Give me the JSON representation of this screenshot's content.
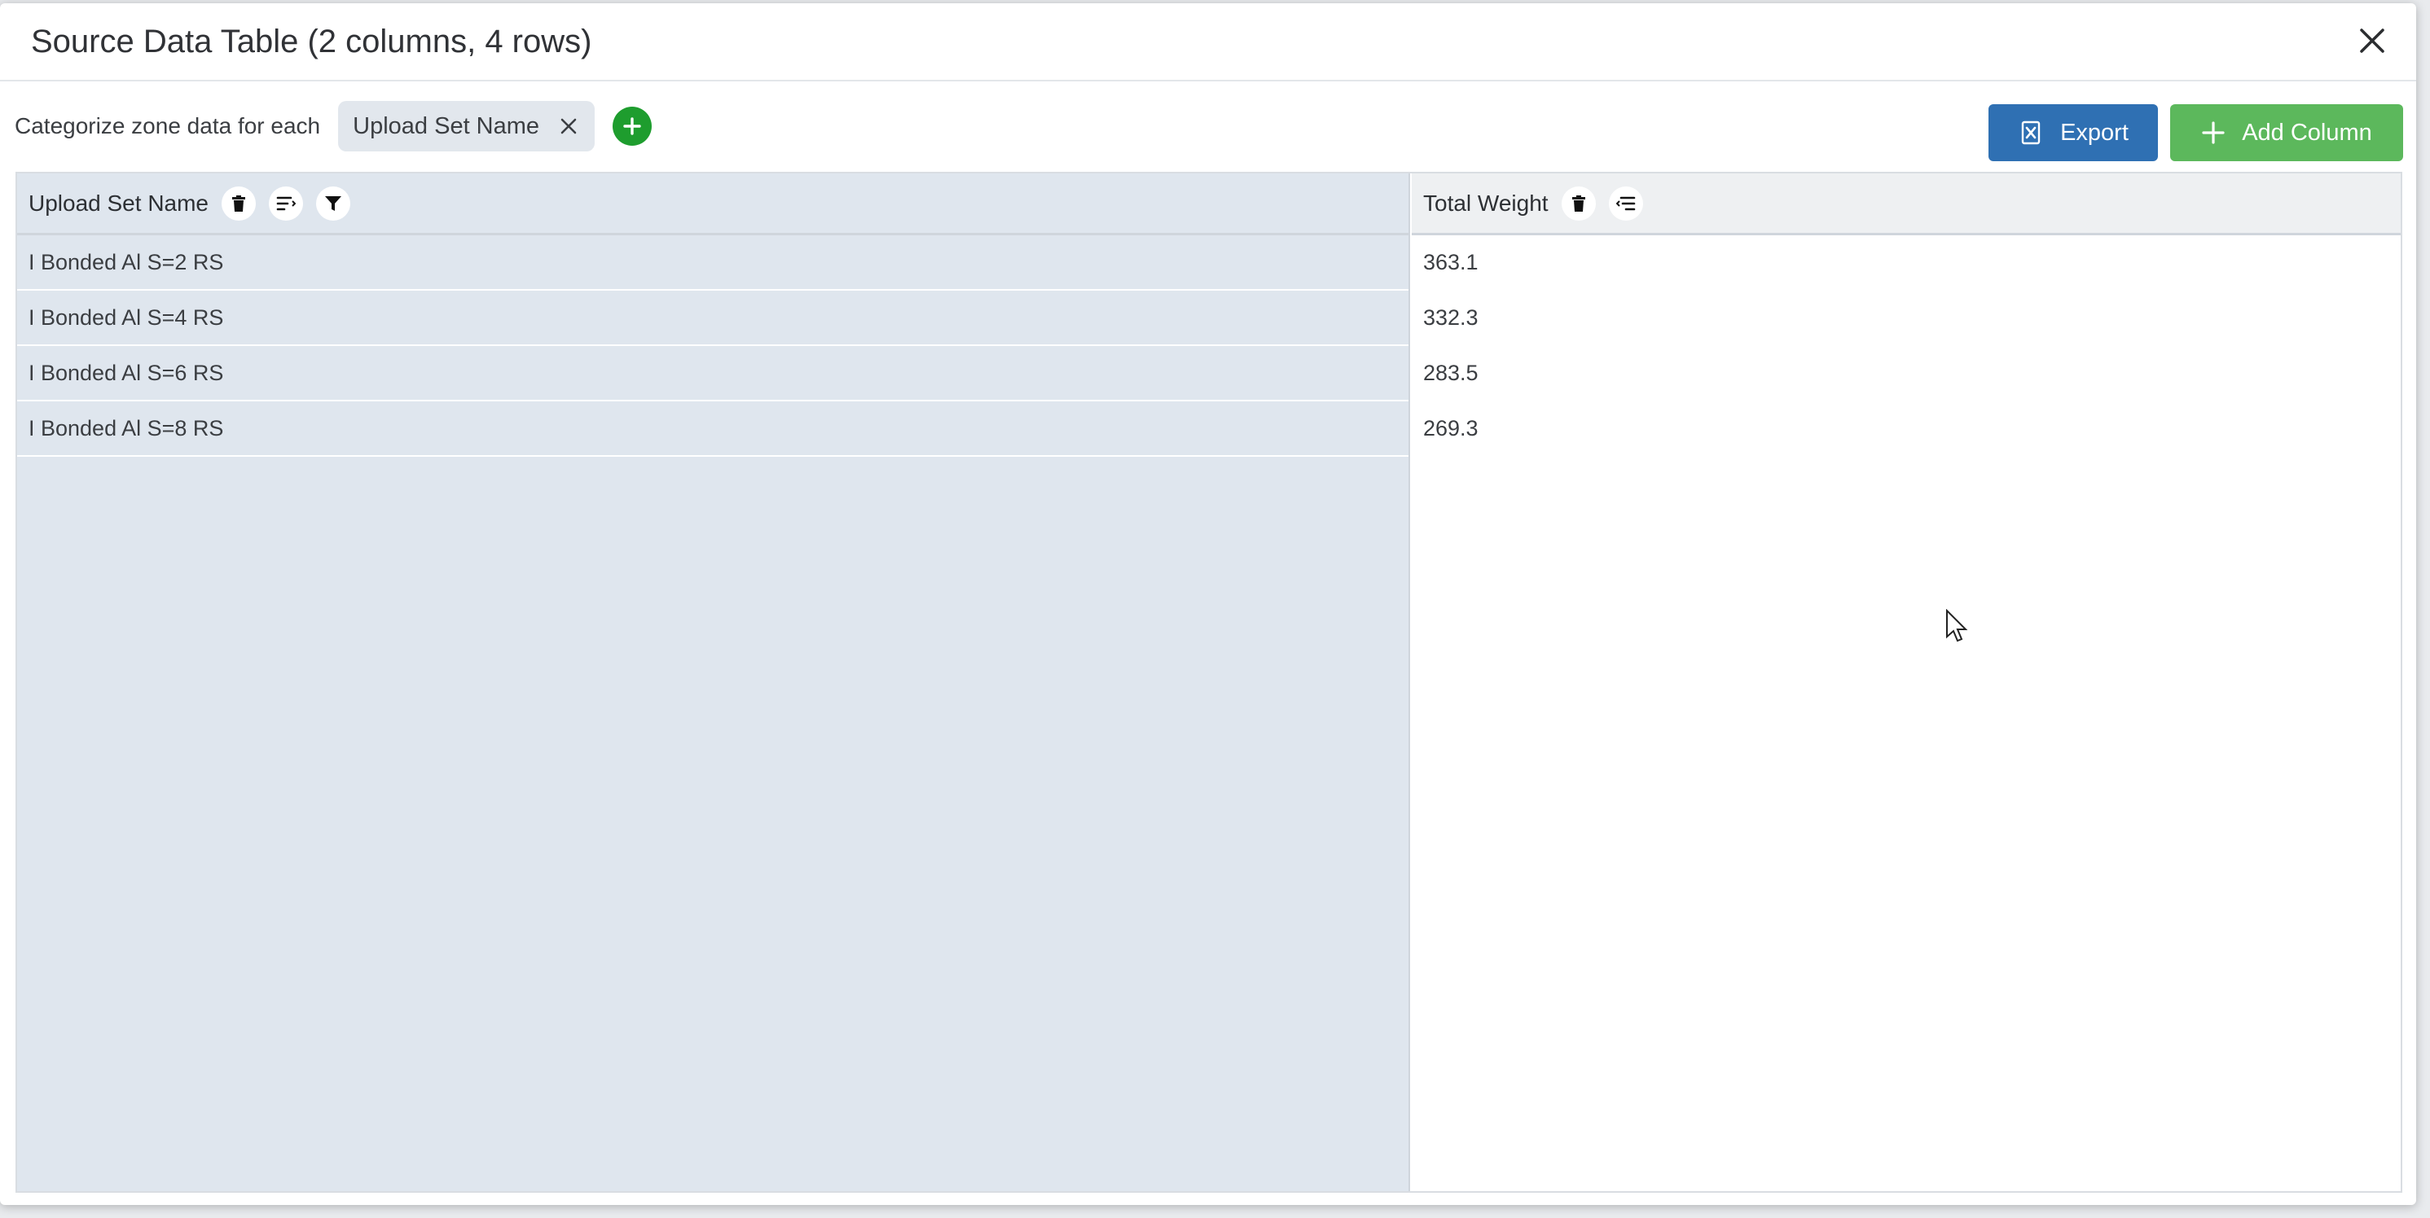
{
  "modal": {
    "title": "Source Data Table (2 columns, 4 rows)"
  },
  "toolbar": {
    "label": "Categorize zone data for each",
    "chips": [
      {
        "label": "Upload Set Name"
      }
    ],
    "export_label": "Export",
    "add_column_label": "Add Column"
  },
  "table": {
    "columns": [
      {
        "label": "Upload Set Name",
        "icons": [
          "trash-icon",
          "sort-icon",
          "filter-icon"
        ]
      },
      {
        "label": "Total Weight",
        "icons": [
          "trash-icon",
          "sort-icon"
        ]
      }
    ],
    "rows": [
      {
        "name": "I Bonded Al S=2 RS",
        "weight": "363.1"
      },
      {
        "name": "I Bonded Al S=4 RS",
        "weight": "332.3"
      },
      {
        "name": "I Bonded Al S=6 RS",
        "weight": "283.5"
      },
      {
        "name": "I Bonded Al S=8 RS",
        "weight": "269.3"
      }
    ]
  },
  "colors": {
    "export_button": "#2f70b3",
    "add_column_button": "#5cb85c",
    "add_chip_button": "#1e9d2e",
    "category_column_bg": "#dfe6ee"
  }
}
